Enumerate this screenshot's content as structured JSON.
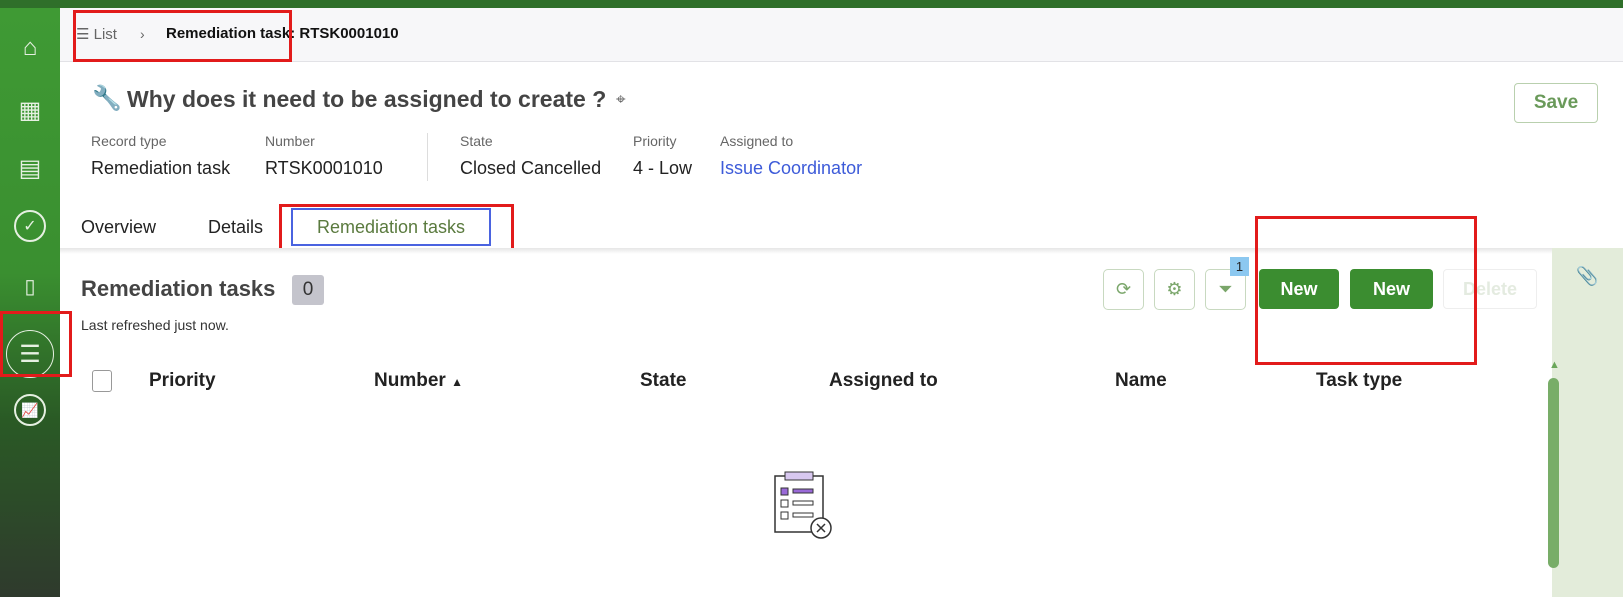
{
  "breadcrumb": {
    "list": "List",
    "current_label": "Remediation task:",
    "current_number": "RTSK0001010"
  },
  "header": {
    "title": "Why does it need to be assigned to create ?",
    "save": "Save",
    "fields": [
      {
        "label": "Record type",
        "value": "Remediation task"
      },
      {
        "label": "Number",
        "value": "RTSK0001010"
      },
      {
        "label": "State",
        "value": "Closed Cancelled"
      },
      {
        "label": "Priority",
        "value": "4 - Low"
      },
      {
        "label": "Assigned to",
        "value": "Issue Coordinator"
      }
    ]
  },
  "tabs": [
    "Overview",
    "Details",
    "Remediation tasks"
  ],
  "list": {
    "title": "Remediation tasks",
    "count": "0",
    "refreshed": "Last refreshed just now.",
    "filter_badge": "1",
    "buttons": {
      "new1": "New",
      "new2": "New",
      "delete": "Delete"
    },
    "columns": [
      "Priority",
      "Number",
      "State",
      "Assigned to",
      "Name",
      "Task type"
    ]
  },
  "colors": {
    "brand": "#3b8d30",
    "link": "#3d5bd9",
    "annotation": "#e21b1b"
  }
}
